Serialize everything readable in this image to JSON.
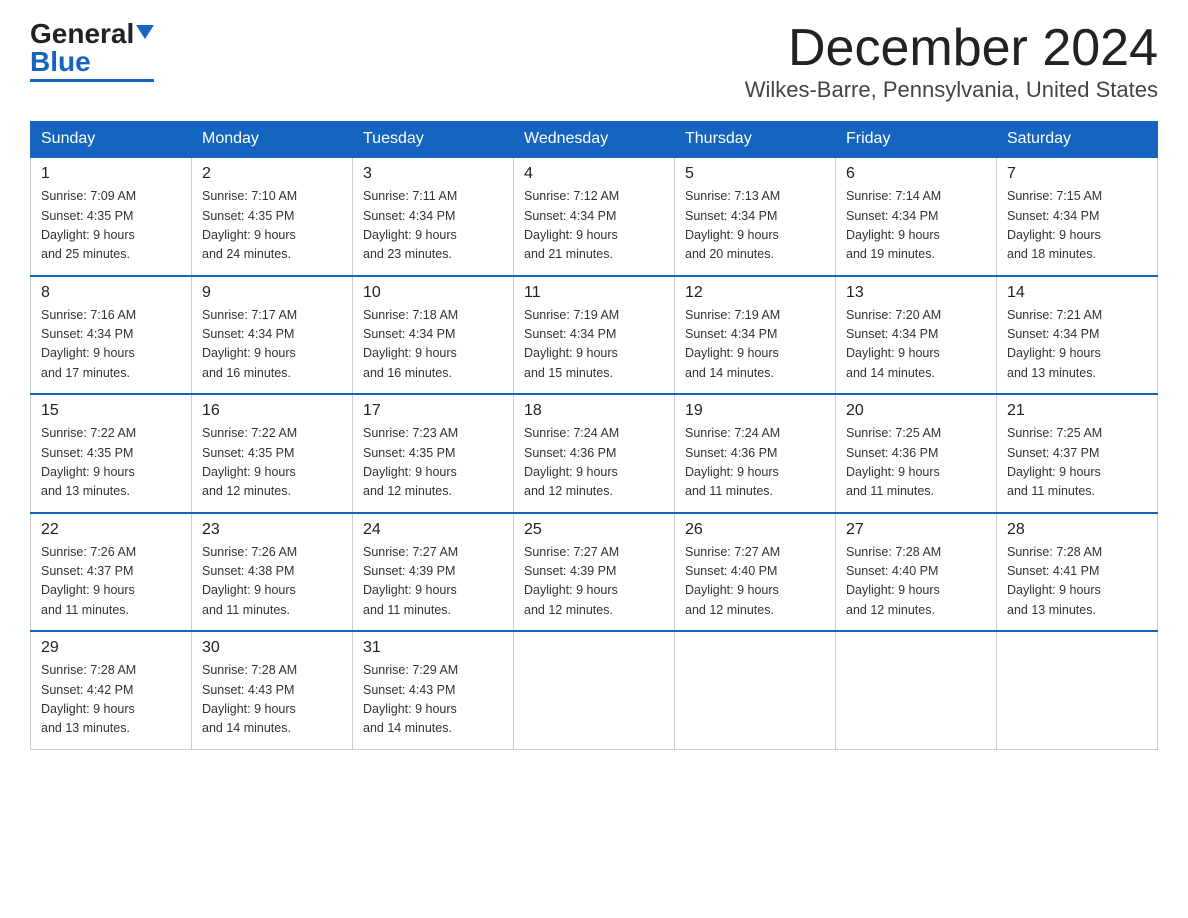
{
  "header": {
    "logo_text_black": "General",
    "logo_text_blue": "Blue",
    "month_title": "December 2024",
    "location": "Wilkes-Barre, Pennsylvania, United States"
  },
  "weekdays": [
    "Sunday",
    "Monday",
    "Tuesday",
    "Wednesday",
    "Thursday",
    "Friday",
    "Saturday"
  ],
  "weeks": [
    [
      {
        "day": "1",
        "sunrise": "7:09 AM",
        "sunset": "4:35 PM",
        "daylight": "9 hours and 25 minutes."
      },
      {
        "day": "2",
        "sunrise": "7:10 AM",
        "sunset": "4:35 PM",
        "daylight": "9 hours and 24 minutes."
      },
      {
        "day": "3",
        "sunrise": "7:11 AM",
        "sunset": "4:34 PM",
        "daylight": "9 hours and 23 minutes."
      },
      {
        "day": "4",
        "sunrise": "7:12 AM",
        "sunset": "4:34 PM",
        "daylight": "9 hours and 21 minutes."
      },
      {
        "day": "5",
        "sunrise": "7:13 AM",
        "sunset": "4:34 PM",
        "daylight": "9 hours and 20 minutes."
      },
      {
        "day": "6",
        "sunrise": "7:14 AM",
        "sunset": "4:34 PM",
        "daylight": "9 hours and 19 minutes."
      },
      {
        "day": "7",
        "sunrise": "7:15 AM",
        "sunset": "4:34 PM",
        "daylight": "9 hours and 18 minutes."
      }
    ],
    [
      {
        "day": "8",
        "sunrise": "7:16 AM",
        "sunset": "4:34 PM",
        "daylight": "9 hours and 17 minutes."
      },
      {
        "day": "9",
        "sunrise": "7:17 AM",
        "sunset": "4:34 PM",
        "daylight": "9 hours and 16 minutes."
      },
      {
        "day": "10",
        "sunrise": "7:18 AM",
        "sunset": "4:34 PM",
        "daylight": "9 hours and 16 minutes."
      },
      {
        "day": "11",
        "sunrise": "7:19 AM",
        "sunset": "4:34 PM",
        "daylight": "9 hours and 15 minutes."
      },
      {
        "day": "12",
        "sunrise": "7:19 AM",
        "sunset": "4:34 PM",
        "daylight": "9 hours and 14 minutes."
      },
      {
        "day": "13",
        "sunrise": "7:20 AM",
        "sunset": "4:34 PM",
        "daylight": "9 hours and 14 minutes."
      },
      {
        "day": "14",
        "sunrise": "7:21 AM",
        "sunset": "4:34 PM",
        "daylight": "9 hours and 13 minutes."
      }
    ],
    [
      {
        "day": "15",
        "sunrise": "7:22 AM",
        "sunset": "4:35 PM",
        "daylight": "9 hours and 13 minutes."
      },
      {
        "day": "16",
        "sunrise": "7:22 AM",
        "sunset": "4:35 PM",
        "daylight": "9 hours and 12 minutes."
      },
      {
        "day": "17",
        "sunrise": "7:23 AM",
        "sunset": "4:35 PM",
        "daylight": "9 hours and 12 minutes."
      },
      {
        "day": "18",
        "sunrise": "7:24 AM",
        "sunset": "4:36 PM",
        "daylight": "9 hours and 12 minutes."
      },
      {
        "day": "19",
        "sunrise": "7:24 AM",
        "sunset": "4:36 PM",
        "daylight": "9 hours and 11 minutes."
      },
      {
        "day": "20",
        "sunrise": "7:25 AM",
        "sunset": "4:36 PM",
        "daylight": "9 hours and 11 minutes."
      },
      {
        "day": "21",
        "sunrise": "7:25 AM",
        "sunset": "4:37 PM",
        "daylight": "9 hours and 11 minutes."
      }
    ],
    [
      {
        "day": "22",
        "sunrise": "7:26 AM",
        "sunset": "4:37 PM",
        "daylight": "9 hours and 11 minutes."
      },
      {
        "day": "23",
        "sunrise": "7:26 AM",
        "sunset": "4:38 PM",
        "daylight": "9 hours and 11 minutes."
      },
      {
        "day": "24",
        "sunrise": "7:27 AM",
        "sunset": "4:39 PM",
        "daylight": "9 hours and 11 minutes."
      },
      {
        "day": "25",
        "sunrise": "7:27 AM",
        "sunset": "4:39 PM",
        "daylight": "9 hours and 12 minutes."
      },
      {
        "day": "26",
        "sunrise": "7:27 AM",
        "sunset": "4:40 PM",
        "daylight": "9 hours and 12 minutes."
      },
      {
        "day": "27",
        "sunrise": "7:28 AM",
        "sunset": "4:40 PM",
        "daylight": "9 hours and 12 minutes."
      },
      {
        "day": "28",
        "sunrise": "7:28 AM",
        "sunset": "4:41 PM",
        "daylight": "9 hours and 13 minutes."
      }
    ],
    [
      {
        "day": "29",
        "sunrise": "7:28 AM",
        "sunset": "4:42 PM",
        "daylight": "9 hours and 13 minutes."
      },
      {
        "day": "30",
        "sunrise": "7:28 AM",
        "sunset": "4:43 PM",
        "daylight": "9 hours and 14 minutes."
      },
      {
        "day": "31",
        "sunrise": "7:29 AM",
        "sunset": "4:43 PM",
        "daylight": "9 hours and 14 minutes."
      },
      null,
      null,
      null,
      null
    ]
  ],
  "labels": {
    "sunrise": "Sunrise:",
    "sunset": "Sunset:",
    "daylight": "Daylight:"
  }
}
